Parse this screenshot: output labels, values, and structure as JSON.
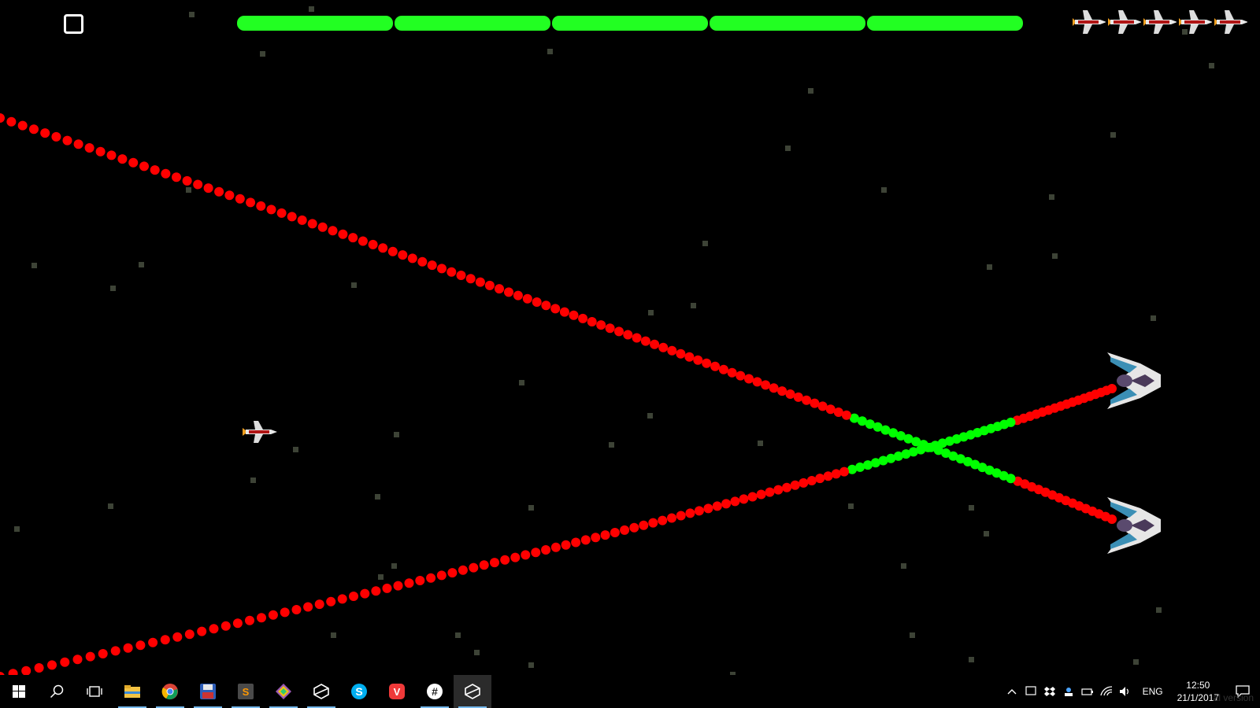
{
  "game": {
    "health_segments": 5,
    "health_color": "#22ff22",
    "lives": 5,
    "bullet_color": "#ff0000",
    "bullet_highlight_color": "#00ff00",
    "enemy_count": 2
  },
  "taskbar": {
    "apps": [
      {
        "name": "start-button",
        "icon": "windows-logo-icon"
      },
      {
        "name": "search-button",
        "icon": "search-icon"
      },
      {
        "name": "task-view-button",
        "icon": "task-view-icon"
      },
      {
        "name": "file-explorer-button",
        "icon": "folder-icon"
      },
      {
        "name": "chrome-button",
        "icon": "chrome-icon"
      },
      {
        "name": "save-app-button",
        "icon": "floppy-disk-icon"
      },
      {
        "name": "sublime-text-button",
        "icon": "sublime-text-icon"
      },
      {
        "name": "git-app-button",
        "icon": "git-icon"
      },
      {
        "name": "unity-button",
        "icon": "unity-icon"
      },
      {
        "name": "skype-button",
        "icon": "skype-icon"
      },
      {
        "name": "vivaldi-button",
        "icon": "vivaldi-icon"
      },
      {
        "name": "slack-button",
        "icon": "slack-icon"
      },
      {
        "name": "unity-active-button",
        "icon": "unity-icon"
      }
    ],
    "language": "ENG",
    "time": "12:50",
    "date": "21/1/2017",
    "watermark": "al version"
  }
}
